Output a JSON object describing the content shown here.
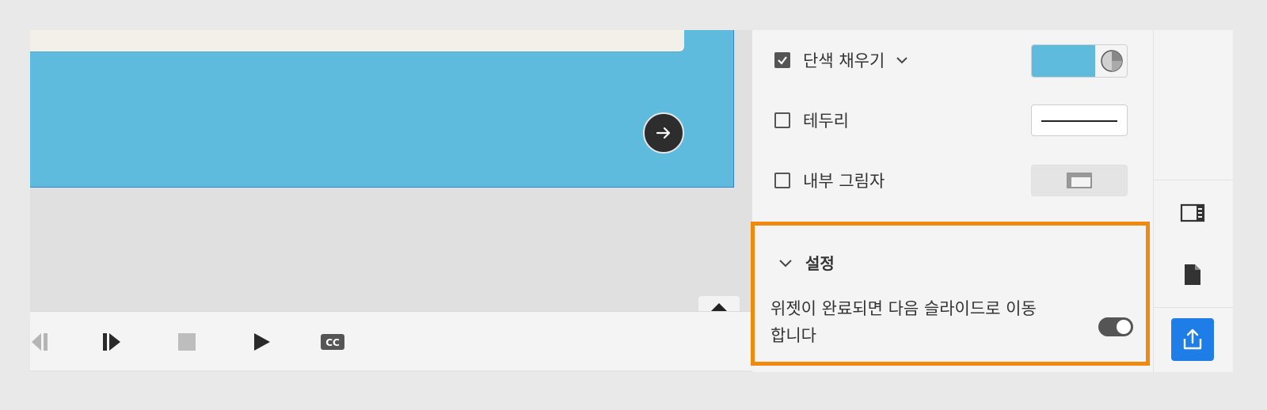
{
  "fill": {
    "label": "단색 채우기",
    "checked": true,
    "color": "#5fbbdd"
  },
  "border": {
    "label": "테두리",
    "checked": false
  },
  "inner_shadow": {
    "label": "내부 그림자",
    "checked": false
  },
  "settings": {
    "title": "설정",
    "line1": "위젯이 완료되면 다음 슬라이드로 이동",
    "line2": "합니다",
    "toggle_on": true
  },
  "playbar": {
    "icons": [
      "rewind-icon",
      "step-forward-icon",
      "stop-icon",
      "play-icon",
      "closed-captions-icon"
    ],
    "cc_label": "CC"
  },
  "rail": {
    "icons": [
      "properties-panel-icon",
      "document-icon",
      "publish-share-icon"
    ],
    "active": "publish-share-icon"
  },
  "colors": {
    "highlight": "#f08a0f",
    "accent": "#1e7de6",
    "slide": "#5fbbdd"
  }
}
